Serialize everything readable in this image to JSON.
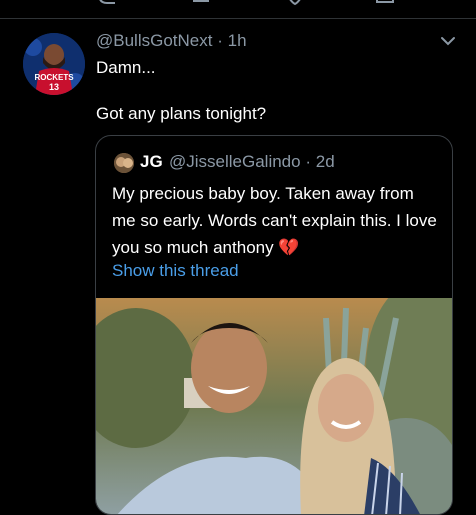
{
  "reply_tweet": {
    "handle": "@BullsGotNext",
    "separator": "·",
    "time": "1h",
    "line1": "Damn...",
    "line2": "Got any plans tonight?"
  },
  "quoted_tweet": {
    "name": "JG",
    "handle": "@JisselleGalindo",
    "separator": "·",
    "time": "2d",
    "text": "My precious baby boy. Taken away from me so early. Words can't explain this. I love you so much anthony",
    "emoji": "💔",
    "show_thread": "Show this thread"
  },
  "avatar": {
    "jersey_text": "ROCKETS",
    "jersey_number": "13"
  },
  "icons": {
    "reply": "reply-icon",
    "retweet": "retweet-icon",
    "like": "like-icon",
    "share": "share-icon",
    "more": "chevron-down-icon"
  },
  "colors": {
    "background": "#000000",
    "secondary_text": "#8b98a5",
    "link": "#4a9ee8",
    "border": "#3a3f44"
  }
}
